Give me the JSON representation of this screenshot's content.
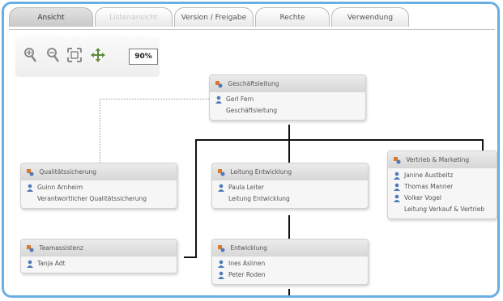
{
  "tabs": [
    {
      "label": "Ansicht"
    },
    {
      "label": "Listenansicht"
    },
    {
      "label": "Version / Freigabe"
    },
    {
      "label": "Rechte"
    },
    {
      "label": "Verwendung"
    }
  ],
  "toolbar": {
    "icons": [
      "zoom-in-icon",
      "zoom-out-icon",
      "fit-to-screen-icon",
      "navigate-icon"
    ],
    "zoom_value": "90%"
  },
  "nodes": {
    "geschaeftsleitung": {
      "title": "Geschäftsleitung",
      "person": "Gerl Fern",
      "role": "Geschäftsleitung"
    },
    "qualitaet": {
      "title": "Qualitätssicherung",
      "person": "Guinn Arnheim",
      "role": "Verantwortlicher Qualitätssicherung"
    },
    "leitung_entwicklung": {
      "title": "Leitung Entwicklung",
      "person": "Paula Leiter",
      "role": "Leitung Entwicklung"
    },
    "vertrieb": {
      "title": "Vertrieb & Marketing",
      "persons": [
        "Janine Austbeltz",
        "Thomas Manner",
        "Volker Vogel"
      ],
      "role": "Leitung Verkauf & Vertrieb"
    },
    "teamassistenz": {
      "title": "Teamassistenz",
      "person": "Tanja Adt"
    },
    "entwicklung": {
      "title": "Entwicklung",
      "persons": [
        "Ines Aslinen",
        "Peter Roden"
      ]
    }
  },
  "colors": {
    "frame": "#6aaee2",
    "unit_icon": "#d9772a",
    "person_icon": "#4f79b8"
  }
}
